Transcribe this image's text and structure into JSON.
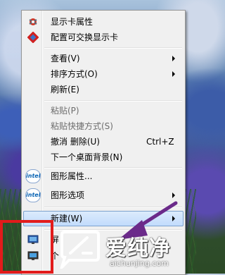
{
  "menu": {
    "items": [
      {
        "label": "显示卡属性"
      },
      {
        "label": "配置可交换显示卡"
      },
      {
        "label": "查看(V)"
      },
      {
        "label": "排序方式(O)"
      },
      {
        "label": "刷新(E)"
      },
      {
        "label": "粘贴(P)"
      },
      {
        "label": "粘贴快捷方式(S)"
      },
      {
        "label": "撤消 删除(U)",
        "shortcut": "Ctrl+Z"
      },
      {
        "label": "下一个桌面背景(N)"
      },
      {
        "label": "图形属性..."
      },
      {
        "label": "图形选项"
      },
      {
        "label": "新建(W)"
      },
      {
        "label": "屏"
      },
      {
        "label": "个"
      }
    ]
  },
  "icons": {
    "display_card": "display-card-icon",
    "switchable": "switchable-graphics-icon",
    "intel": "intel-logo-icon",
    "screen": "screen-resolution-icon",
    "personalize": "personalize-icon",
    "intel_text": "intel"
  },
  "watermark": {
    "brand_cn": "爱纯净",
    "url": "aichunjing.com"
  },
  "colors": {
    "highlight_red": "#e21b1b",
    "arrow_purple": "#6b2a8a",
    "menu_hover": "#c1dbfc"
  }
}
